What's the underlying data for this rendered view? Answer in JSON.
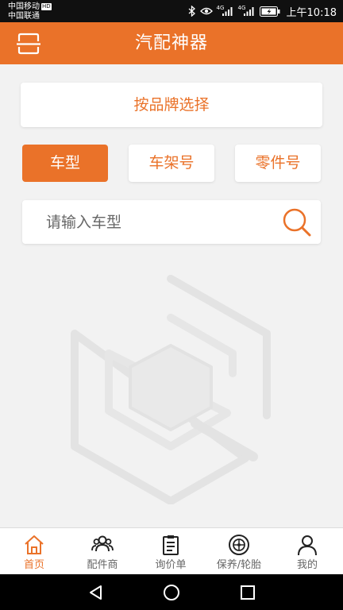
{
  "status_bar": {
    "carrier1": "中国移动",
    "hd_badge": "HD",
    "carrier2": "中国联通",
    "net1": "4G",
    "net2": "4G",
    "time": "上午10:18"
  },
  "app_bar": {
    "title": "汽配神器",
    "scan_icon": "scan-icon",
    "background": "#ea7229"
  },
  "brand_select": {
    "label": "按品牌选择"
  },
  "tabs": [
    {
      "label": "车型",
      "active": true
    },
    {
      "label": "车架号",
      "active": false
    },
    {
      "label": "零件号",
      "active": false
    }
  ],
  "search": {
    "placeholder": "请输入车型",
    "value": "",
    "icon": "search-icon"
  },
  "bottom_nav": {
    "items": [
      {
        "label": "首页",
        "icon": "home-icon",
        "active": true
      },
      {
        "label": "配件商",
        "icon": "users-icon",
        "active": false
      },
      {
        "label": "询价单",
        "icon": "clipboard-icon",
        "active": false
      },
      {
        "label": "保养/轮胎",
        "icon": "tire-icon",
        "active": false
      },
      {
        "label": "我的",
        "icon": "person-icon",
        "active": false
      }
    ]
  },
  "colors": {
    "accent": "#ea7229",
    "background": "#f2f2f2",
    "status_bar": "#101010",
    "nav_inactive": "#666666"
  }
}
